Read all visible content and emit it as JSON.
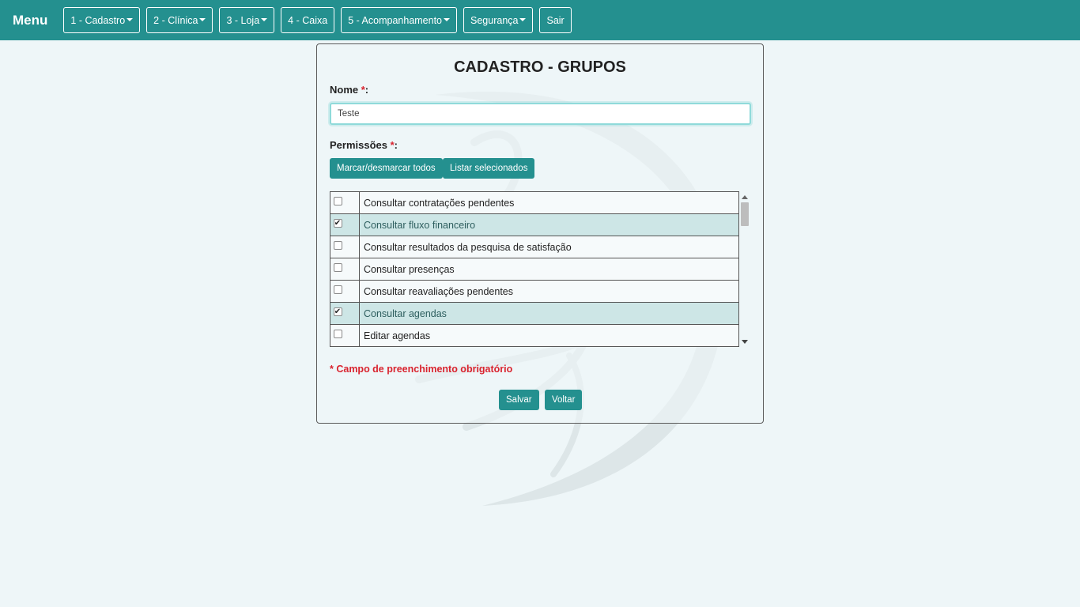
{
  "navbar": {
    "brand": "Menu",
    "items": [
      {
        "label": "1 - Cadastro",
        "dropdown": true
      },
      {
        "label": "2 - Clínica",
        "dropdown": true
      },
      {
        "label": "3 - Loja",
        "dropdown": true
      },
      {
        "label": "4 - Caixa",
        "dropdown": false
      },
      {
        "label": "5 - Acompanhamento",
        "dropdown": true
      },
      {
        "label": "Segurança",
        "dropdown": true
      },
      {
        "label": "Sair",
        "dropdown": false
      }
    ]
  },
  "form": {
    "title": "CADASTRO - GRUPOS",
    "nome_label": "Nome ",
    "required_mark": "*",
    "label_colon": ":",
    "nome_value": "Teste",
    "permissoes_label": "Permissões ",
    "toggle_all_label": "Marcar/desmarcar todos",
    "list_selected_label": "Listar selecionados",
    "permissions": [
      {
        "label": "Consultar contratações pendentes",
        "checked": false
      },
      {
        "label": "Consultar fluxo financeiro",
        "checked": true
      },
      {
        "label": "Consultar resultados da pesquisa de satisfação",
        "checked": false
      },
      {
        "label": "Consultar presenças",
        "checked": false
      },
      {
        "label": "Consultar reavaliações pendentes",
        "checked": false
      },
      {
        "label": "Consultar agendas",
        "checked": true
      },
      {
        "label": "Editar agendas",
        "checked": false
      }
    ],
    "required_note": "* Campo de preenchimento obrigatório",
    "save_label": "Salvar",
    "back_label": "Voltar"
  },
  "colors": {
    "primary": "#24908f",
    "required": "#d9232e",
    "checked_row": "#cde6e6",
    "background": "#eef6f8"
  }
}
